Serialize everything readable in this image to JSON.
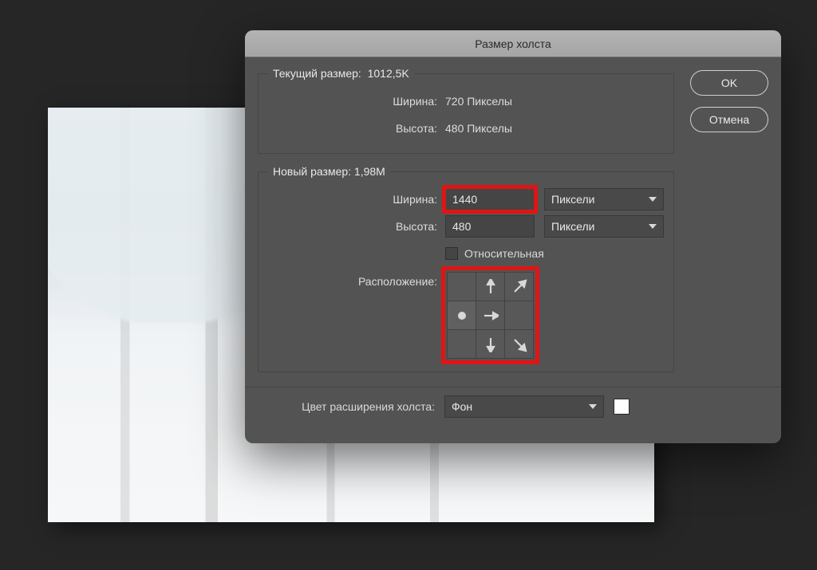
{
  "dialog": {
    "title": "Размер холста",
    "current": {
      "legend_label": "Текущий размер:",
      "legend_value": "1012,5K",
      "width_label": "Ширина:",
      "width_value": "720 Пикселы",
      "height_label": "Высота:",
      "height_value": "480 Пикселы"
    },
    "new": {
      "legend_label": "Новый размер:",
      "legend_value": "1,98M",
      "width_label": "Ширина:",
      "width_value": "1440",
      "width_unit": "Пиксели",
      "height_label": "Высота:",
      "height_value": "480",
      "height_unit": "Пиксели",
      "relative_label": "Относительная",
      "anchor_label": "Расположение:",
      "anchor_selected": "middle-left"
    },
    "extension": {
      "label": "Цвет расширения холста:",
      "value": "Фон",
      "swatch_color": "#ffffff"
    },
    "buttons": {
      "ok": "OK",
      "cancel": "Отмена"
    }
  }
}
